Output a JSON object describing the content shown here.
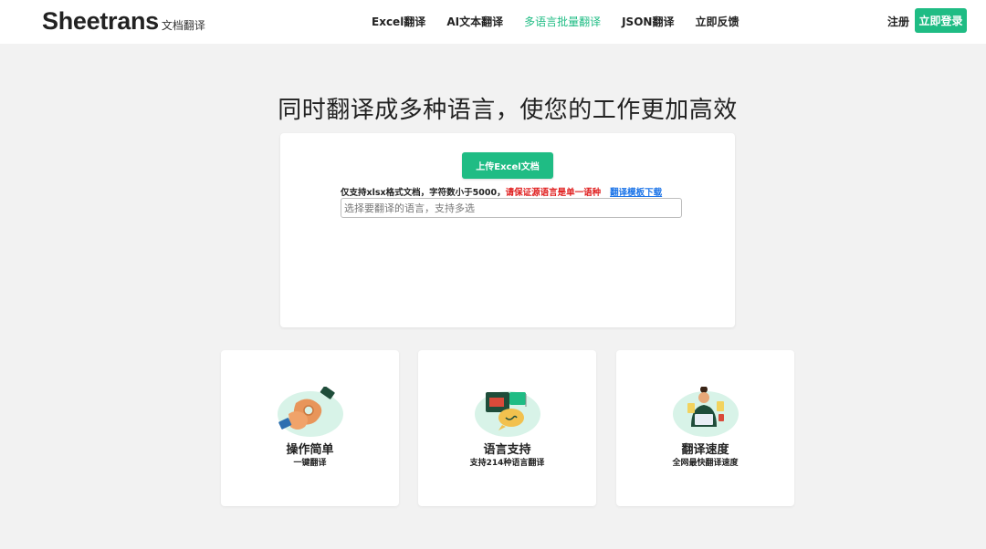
{
  "header": {
    "brand_name": "Sheetrans",
    "brand_sub": "文档翻译",
    "nav": [
      {
        "label": "Excel翻译",
        "active": false
      },
      {
        "label": "AI文本翻译",
        "active": false
      },
      {
        "label": "多语言批量翻译",
        "active": true
      },
      {
        "label": "JSON翻译",
        "active": false
      },
      {
        "label": "立即反馈",
        "active": false
      }
    ],
    "register": "注册",
    "login": "立即登录"
  },
  "headline": "同时翻译成多种语言，使您的工作更加高效",
  "upload": {
    "button": "上传Excel文档",
    "notice": "仅支持xlsx格式文档，字符数小于5000，",
    "warning": "请保证源语言是单一语种",
    "template_link": "翻译模板下载",
    "select_placeholder": "选择要翻译的语言，支持多选"
  },
  "features": [
    {
      "title": "操作简单",
      "desc": "一键翻译",
      "icon": "hands-icon"
    },
    {
      "title": "语言支持",
      "desc": "支持214种语言翻译",
      "icon": "language-bubbles-icon"
    },
    {
      "title": "翻译速度",
      "desc": "全网最快翻译速度",
      "icon": "translator-person-icon"
    }
  ],
  "colors": {
    "accent": "#1fbc84",
    "warning": "#e02020",
    "link": "#1a73e8",
    "background": "#f2f2f2"
  }
}
